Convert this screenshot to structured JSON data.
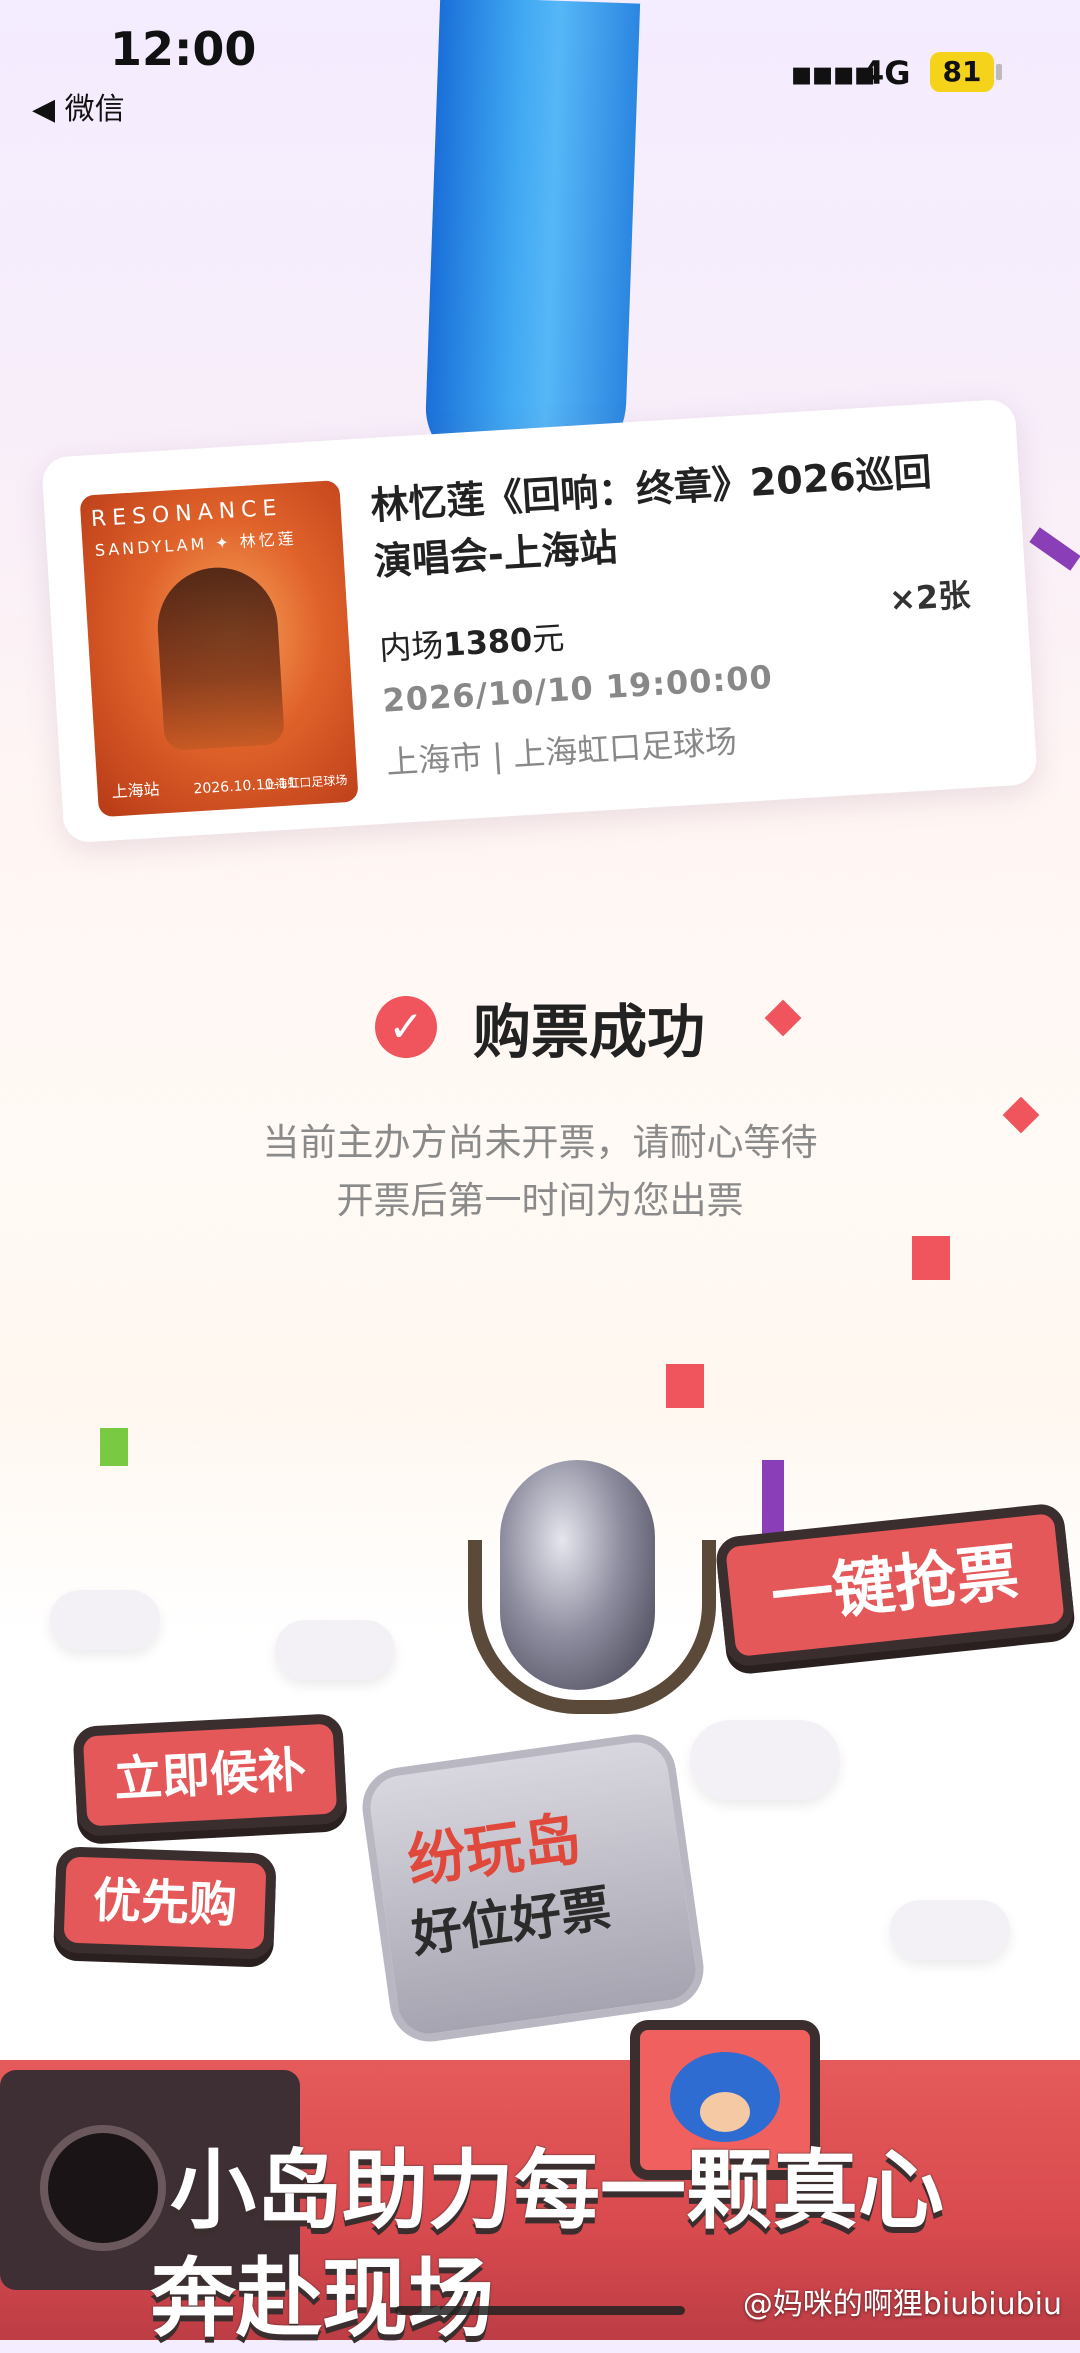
{
  "status_bar": {
    "time": "12:00",
    "back_label": "◀ 微信",
    "network": "4G",
    "battery": "81"
  },
  "ticket": {
    "poster": {
      "brand": "RESONANCE",
      "sub": "SANDYLAM ✦ 林忆莲",
      "city": "上海站",
      "date": "2026.10.10-11",
      "venue": "上海虹口足球场"
    },
    "title": "林忆莲《回响：终章》2026巡回演唱会-上海站",
    "quantity": "×2张",
    "price_prefix": "内场",
    "price_value": "1380",
    "price_suffix": "元",
    "datetime": "2026/10/10 19:00:00",
    "location": "上海市 | 上海虹口足球场"
  },
  "result": {
    "title": "购票成功",
    "message_line1": "当前主办方尚未开票，请耐心等待",
    "message_line2": "开票后第一时间为您出票"
  },
  "promo": {
    "sign_grab": "一键抢票",
    "sign_waitlist": "立即候补",
    "sign_priority": "优先购",
    "board_line1": "纷玩岛",
    "board_line2": "好位好票",
    "slogan_line1": "小岛助力每一颗真心",
    "slogan_line2": "奔赴现场"
  },
  "watermark": "@妈咪的啊狸biubiubiu",
  "colors": {
    "accent": "#f0545c",
    "blue_decor": "#3fa7f2",
    "confetti": [
      "#f0545c",
      "#8a3fb8",
      "#7ac943"
    ]
  }
}
